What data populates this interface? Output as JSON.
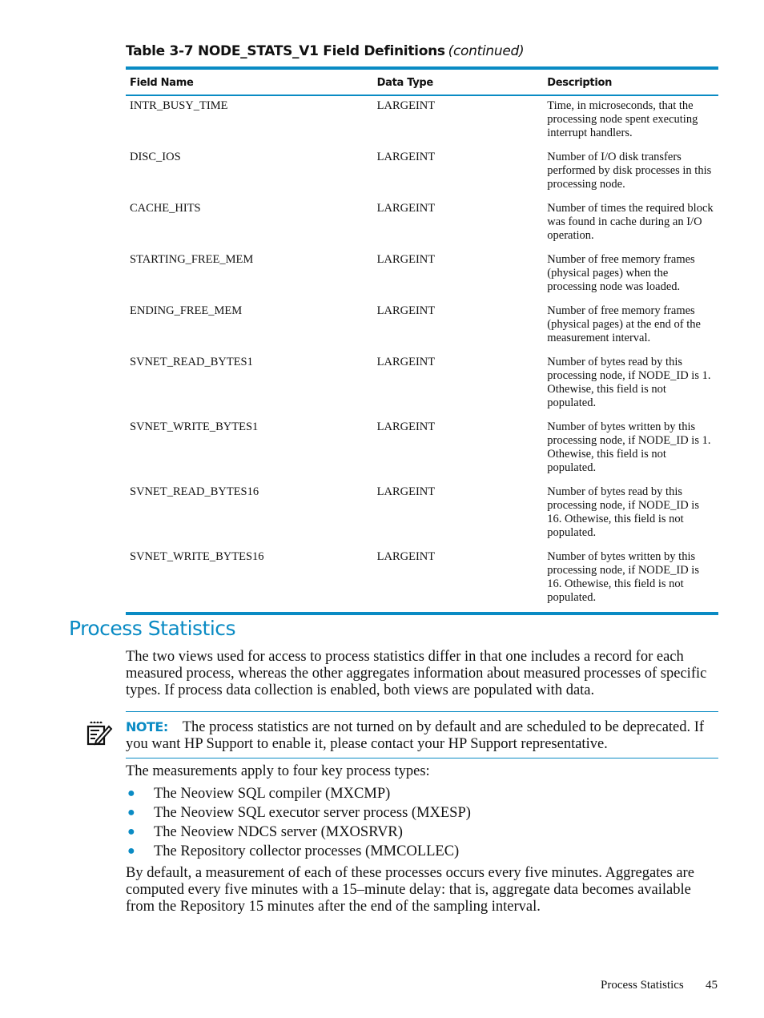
{
  "table": {
    "caption": "Table 3-7 NODE_STATS_V1 Field Definitions",
    "caption_suffix": "(continued)",
    "columns": [
      "Field Name",
      "Data Type",
      "Description"
    ],
    "rows": [
      {
        "field": "INTR_BUSY_TIME",
        "type": "LARGEINT",
        "description": "Time, in microseconds, that the processing node spent executing interrupt handlers."
      },
      {
        "field": "DISC_IOS",
        "type": "LARGEINT",
        "description": "Number of I/O disk transfers performed by disk processes in this processing node."
      },
      {
        "field": "CACHE_HITS",
        "type": "LARGEINT",
        "description": "Number of times the required block was found in cache during an I/O operation."
      },
      {
        "field": "STARTING_FREE_MEM",
        "type": "LARGEINT",
        "description": "Number of free memory frames (physical pages) when the processing node was loaded."
      },
      {
        "field": "ENDING_FREE_MEM",
        "type": "LARGEINT",
        "description": "Number of free memory frames (physical pages) at the end of the measurement interval."
      },
      {
        "field": "SVNET_READ_BYTES1",
        "type": "LARGEINT",
        "description": "Number of bytes read by this processing node, if NODE_ID is 1. Othewise, this field is not populated."
      },
      {
        "field": "SVNET_WRITE_BYTES1",
        "type": "LARGEINT",
        "description": "Number of bytes written by this processing node, if NODE_ID is 1. Othewise, this field is not populated."
      },
      {
        "field": "SVNET_READ_BYTES16",
        "type": "LARGEINT",
        "description": "Number of bytes read by this processing node, if NODE_ID is 16. Othewise, this field is not populated."
      },
      {
        "field": "SVNET_WRITE_BYTES16",
        "type": "LARGEINT",
        "description": "Number of bytes written by this processing node, if NODE_ID is 16. Othewise, this field is not populated."
      }
    ]
  },
  "section": {
    "title": "Process Statistics",
    "intro": "The two views used for access to process statistics differ in that one includes a record for each measured process, whereas the other aggregates information about measured processes of specific types. If process data collection is enabled, both views are populated with data.",
    "note_label": "NOTE:",
    "note_text": "The process statistics are not turned on by default and are scheduled to be deprecated. If you want HP Support to enable it, please contact your HP Support representative.",
    "list_intro": "The measurements apply to four key process types:",
    "list_items": [
      "The Neoview SQL compiler (MXCMP)",
      "The Neoview SQL executor server process (MXESP)",
      "The Neoview NDCS server (MXOSRVR)",
      "The Repository collector processes (MMCOLLEC)"
    ],
    "closing": "By default, a measurement of each of these processes occurs every five minutes. Aggregates are computed every five minutes with a 15–minute delay: that is, aggregate data becomes available from the Repository 15 minutes after the end of the sampling interval."
  },
  "footer": {
    "section_name": "Process Statistics",
    "page_number": "45"
  },
  "colors": {
    "accent": "#0a8bc4",
    "text": "#111111"
  },
  "icons": {
    "note": "note-pencil-icon",
    "bullet": "bullet-dot-icon"
  }
}
